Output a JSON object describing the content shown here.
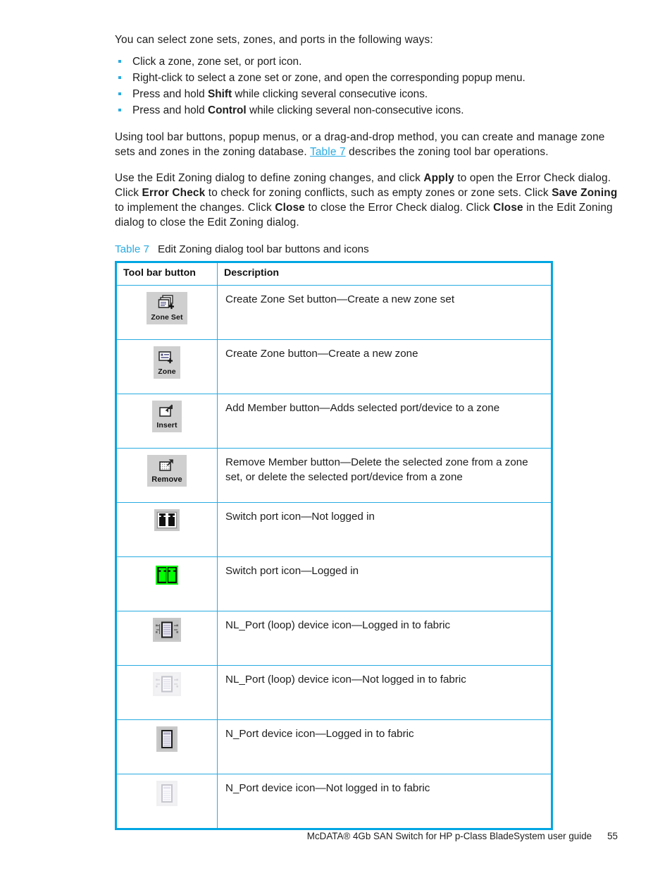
{
  "document": {
    "intro": "You can select zone sets, zones, and ports in the following ways:",
    "bullets": [
      {
        "pre": "Click a zone, zone set, or port icon.",
        "bold": "",
        "post": ""
      },
      {
        "pre": "Right-click to select a zone set or zone, and open the corresponding popup menu.",
        "bold": "",
        "post": ""
      },
      {
        "pre": "Press and hold ",
        "bold": "Shift",
        "post": " while clicking several consecutive icons."
      },
      {
        "pre": "Press and hold ",
        "bold": "Control",
        "post": " while clicking several non-consecutive icons."
      }
    ],
    "paragraph_2": {
      "part1": "Using tool bar buttons, popup menus, or a drag-and-drop method, you can create and manage zone sets and zones in the zoning database. ",
      "link": "Table 7",
      "part2": " describes the zoning tool bar operations."
    },
    "paragraph_3": {
      "s1": "Use the Edit Zoning dialog to define zoning changes, and click ",
      "b1": "Apply",
      "s2": " to open the Error Check dialog. Click ",
      "b2": "Error Check",
      "s3": " to check for zoning conflicts, such as empty zones or zone sets. Click ",
      "b3": "Save Zoning",
      "s4": " to implement the changes. Click ",
      "b4": "Close",
      "s5": " to close the Error Check dialog. Click ",
      "b5": "Close",
      "s6": " in the Edit Zoning dialog to close the Edit Zoning dialog."
    }
  },
  "table": {
    "caption_label": "Table 7",
    "caption_text": "Edit Zoning dialog tool bar buttons and icons",
    "headers": [
      "Tool bar button",
      "Description"
    ],
    "rows": [
      {
        "icon_name": "zone-set-button-icon",
        "button_label": "Zone Set",
        "description": "Create Zone Set button—Create a new zone set"
      },
      {
        "icon_name": "zone-button-icon",
        "button_label": "Zone",
        "description": "Create Zone button—Create a new zone"
      },
      {
        "icon_name": "insert-button-icon",
        "button_label": "Insert",
        "description": "Add Member button—Adds selected port/device to a zone"
      },
      {
        "icon_name": "remove-button-icon",
        "button_label": "Remove",
        "description": "Remove Member button—Delete the selected zone from a zone set, or delete the selected port/device from a zone"
      },
      {
        "icon_name": "switch-port-not-logged-in-icon",
        "button_label": "",
        "description": "Switch port icon—Not logged in"
      },
      {
        "icon_name": "switch-port-logged-in-icon",
        "button_label": "",
        "description": "Switch port icon—Logged in"
      },
      {
        "icon_name": "nl-port-loop-device-logged-in-icon",
        "button_label": "",
        "description": "NL_Port (loop) device icon—Logged in to fabric"
      },
      {
        "icon_name": "nl-port-loop-device-not-logged-in-icon",
        "button_label": "",
        "description": "NL_Port (loop) device icon—Not logged in to fabric"
      },
      {
        "icon_name": "n-port-device-logged-in-icon",
        "button_label": "",
        "description": "N_Port device icon—Logged in to fabric"
      },
      {
        "icon_name": "n-port-device-not-logged-in-icon",
        "button_label": "",
        "description": "N_Port device icon—Not logged in to fabric"
      }
    ]
  },
  "footer": {
    "guide_title": "McDATA® 4Gb SAN Switch for HP p-Class BladeSystem user guide",
    "page_number": "55"
  },
  "colors": {
    "accent": "#29ABE2",
    "table_border": "#00A6E2",
    "text": "#1d1d1d",
    "button_face": "#CFCFCF",
    "logged_in_green": "#00FF00"
  }
}
